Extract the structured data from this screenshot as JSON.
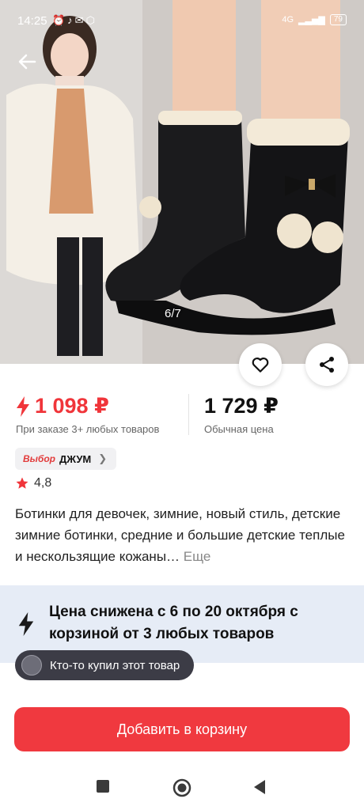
{
  "status_bar": {
    "time": "14:25",
    "network": "4G",
    "battery": "79"
  },
  "gallery": {
    "counter": "6/7"
  },
  "price": {
    "current": "1 098 ₽",
    "current_note": "При заказе 3+ любых товаров",
    "regular": "1 729 ₽",
    "regular_note": "Обычная цена"
  },
  "choice_badge": {
    "label": "Выбор",
    "brand": "ДЖУМ"
  },
  "rating": {
    "value": "4,8",
    "star_color": "#f0353a"
  },
  "product": {
    "title": "Ботинки для девочек, зимние, новый стиль, детские зимние ботинки, средние и большие детские теплые и нескользящие кожаны…",
    "more_label": "Еще"
  },
  "promo": {
    "text": "Цена снижена с 6 по 20 октября с корзиной от 3 любых товаров"
  },
  "toast": {
    "text": "Кто-то купил этот товар"
  },
  "actions": {
    "add_to_cart": "Добавить в корзину"
  },
  "colors": {
    "accent": "#f0393f",
    "promo_bg": "#e6ecf6"
  },
  "icons": [
    "back-arrow-icon",
    "heart-icon",
    "share-icon",
    "lightning-icon",
    "star-icon",
    "chevron-right-icon",
    "square-nav-icon",
    "circle-nav-icon",
    "triangle-back-nav-icon"
  ]
}
